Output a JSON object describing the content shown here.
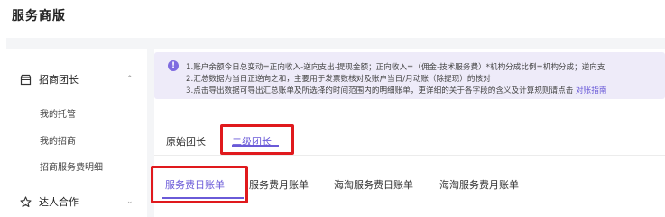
{
  "app": {
    "title": "服务商版"
  },
  "sidebar": {
    "groups": [
      {
        "label": "招商团长",
        "icon": "storefront-icon",
        "expanded": true,
        "items": [
          "我的托管",
          "我的招商",
          "招商服务费明细"
        ]
      },
      {
        "label": "达人合作",
        "icon": "star-icon",
        "expanded": false,
        "items": []
      }
    ]
  },
  "notice": {
    "lines": [
      "1.账户余额今日总变动=正向收入-逆向支出-提现金额；正向收入=（佣金-技术服务费）*机构分成比例=机构分成；逆向支",
      "2.汇总数据为当日正逆向之和，主要用于发票数核对及账户当日/月动账（除提现）的核对",
      "3.点击导出数据可导出汇总账单及所选择的时间范围内的明细账单，更详细的关于各字段的含义及计算规则请点击"
    ],
    "link": "对账指南"
  },
  "tabs_primary": [
    {
      "label": "原始团长",
      "active": false
    },
    {
      "label": "二级团长",
      "active": true
    }
  ],
  "tabs_secondary": [
    {
      "label": "服务费日账单",
      "active": true
    },
    {
      "label": "服务费月账单",
      "active": false
    },
    {
      "label": "海淘服务费日账单",
      "active": false
    },
    {
      "label": "海淘服务费月账单",
      "active": false
    }
  ],
  "colors": {
    "accent": "#6a5ad8",
    "highlight": "#e0191d",
    "notice_bg": "#eeebf9",
    "page_bg": "#f4f5f7"
  }
}
